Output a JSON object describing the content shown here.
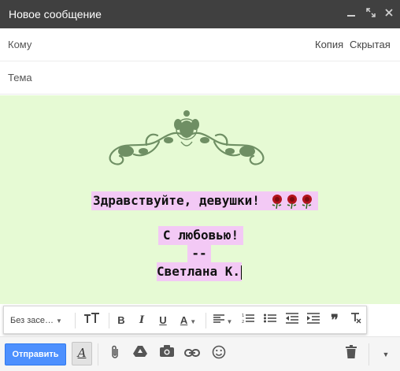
{
  "window": {
    "title": "Новое сообщение",
    "minimize_icon": "minimize-icon",
    "maximize_icon": "expand-icon",
    "close_icon": "close-icon"
  },
  "recipients": {
    "label": "Кому",
    "value": "",
    "cc_label": "Копия",
    "bcc_label": "Скрытая"
  },
  "subject": {
    "placeholder": "Тема",
    "value": ""
  },
  "message": {
    "background_color": "#e6fad4",
    "highlight_color": "#f3c9f5",
    "greeting": "Здравствуйте, девушки!",
    "signature_line1": "С любовью!",
    "signature_line2": "--",
    "signature_line3": "Светлана К."
  },
  "format_toolbar": {
    "font_label": "Без засе…",
    "font_size_icon": "text-size-icon",
    "bold_icon": "bold-icon",
    "italic_icon": "italic-icon",
    "underline_icon": "underline-icon",
    "text_color_icon": "text-color-icon",
    "align_icon": "align-icon",
    "numbered_list_icon": "numbered-list-icon",
    "bulleted_list_icon": "bulleted-list-icon",
    "indent_less_icon": "indent-less-icon",
    "indent_more_icon": "indent-more-icon",
    "quote_icon": "quote-icon",
    "clear_format_icon": "clear-formatting-icon"
  },
  "actions": {
    "send_label": "Отправить",
    "send_color": "#4d90fe",
    "formatting_icon": "formatting-options-icon",
    "attach_icon": "paperclip-icon",
    "drive_icon": "drive-icon",
    "photo_icon": "camera-icon",
    "link_icon": "link-icon",
    "emoji_icon": "emoji-icon",
    "delete_icon": "trash-icon",
    "more_icon": "more-options-icon"
  }
}
